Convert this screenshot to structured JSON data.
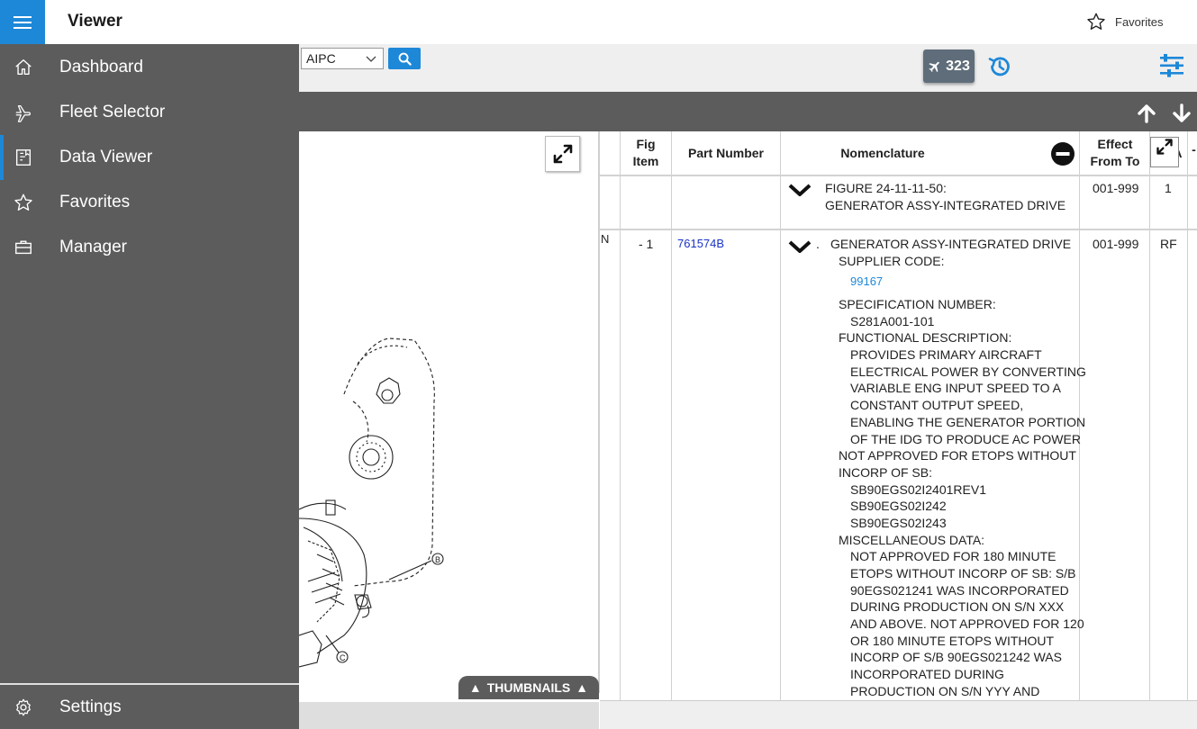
{
  "header": {
    "title": "Viewer",
    "favorites_label": "Favorites"
  },
  "toolbar": {
    "doc_select_value": "AIPC",
    "aircraft_count": "323"
  },
  "sidebar": {
    "items": [
      {
        "label": "Dashboard",
        "icon": "home-icon"
      },
      {
        "label": "Fleet Selector",
        "icon": "airplane-icon"
      },
      {
        "label": "Data Viewer",
        "icon": "book-icon",
        "active": true
      },
      {
        "label": "Favorites",
        "icon": "star-icon"
      },
      {
        "label": "Manager",
        "icon": "briefcase-icon"
      }
    ],
    "settings_label": "Settings"
  },
  "image_pane": {
    "thumbnails_label": "THUMBNAILS",
    "callouts": [
      "B",
      "C"
    ]
  },
  "table": {
    "headers": {
      "fig_item": [
        "Fig",
        "Item"
      ],
      "part_number": "Part Number",
      "nomenclature": "Nomenclature",
      "effect": [
        "Effect",
        "From To"
      ],
      "upa": "UPA"
    },
    "rows": [
      {
        "flag": "",
        "fig_item": "",
        "part_number": "",
        "nomenclature_lines": [
          "FIGURE 24-11-11-50:",
          "GENERATOR ASSY-INTEGRATED DRIVE"
        ],
        "effect": "001-999",
        "upa": "1"
      },
      {
        "flag": "N",
        "fig_item": "- 1",
        "part_number": "761574B",
        "nomenclature_title": "GENERATOR ASSY-INTEGRATED DRIVE",
        "bullet": ".",
        "supplier_label": "SUPPLIER CODE:",
        "supplier_code": "99167",
        "nomenclature_lines": [
          {
            "t": "SPECIFICATION NUMBER:",
            "i": 0
          },
          {
            "t": "S281A001-101",
            "i": 1
          },
          {
            "t": "FUNCTIONAL DESCRIPTION:",
            "i": 0
          },
          {
            "t": "PROVIDES PRIMARY AIRCRAFT",
            "i": 1
          },
          {
            "t": "ELECTRICAL POWER BY CONVERTING",
            "i": 1
          },
          {
            "t": "VARIABLE ENG INPUT SPEED TO A",
            "i": 1
          },
          {
            "t": "CONSTANT OUTPUT SPEED,",
            "i": 1
          },
          {
            "t": "ENABLING THE GENERATOR PORTION",
            "i": 1
          },
          {
            "t": "OF THE IDG TO PRODUCE AC POWER",
            "i": 1
          },
          {
            "t": "NOT APPROVED FOR ETOPS WITHOUT",
            "i": 0
          },
          {
            "t": "INCORP OF SB:",
            "i": 0
          },
          {
            "t": "SB90EGS02I2401REV1",
            "i": 1
          },
          {
            "t": "SB90EGS02I242",
            "i": 1
          },
          {
            "t": "SB90EGS02I243",
            "i": 1
          },
          {
            "t": "MISCELLANEOUS DATA:",
            "i": 0
          },
          {
            "t": "NOT APPROVED FOR 180 MINUTE",
            "i": 1
          },
          {
            "t": "ETOPS WITHOUT INCORP OF SB: S/B",
            "i": 1
          },
          {
            "t": "90EGS021241 WAS INCORPORATED",
            "i": 1
          },
          {
            "t": "DURING PRODUCTION ON S/N XXX",
            "i": 1
          },
          {
            "t": "AND ABOVE. NOT APPROVED FOR 120",
            "i": 1
          },
          {
            "t": "OR 180 MINUTE ETOPS WITHOUT",
            "i": 1
          },
          {
            "t": "INCORP OF S/B 90EGS021242 WAS",
            "i": 1
          },
          {
            "t": "INCORPORATED DURING",
            "i": 1
          },
          {
            "t": "PRODUCTION ON S/N YYY AND",
            "i": 1
          }
        ],
        "effect": "001-999",
        "upa": "RF"
      }
    ]
  },
  "colors": {
    "accent": "#1e88d8",
    "sidebar_bg": "#5c5c5c",
    "part_link": "#1a33c8"
  }
}
